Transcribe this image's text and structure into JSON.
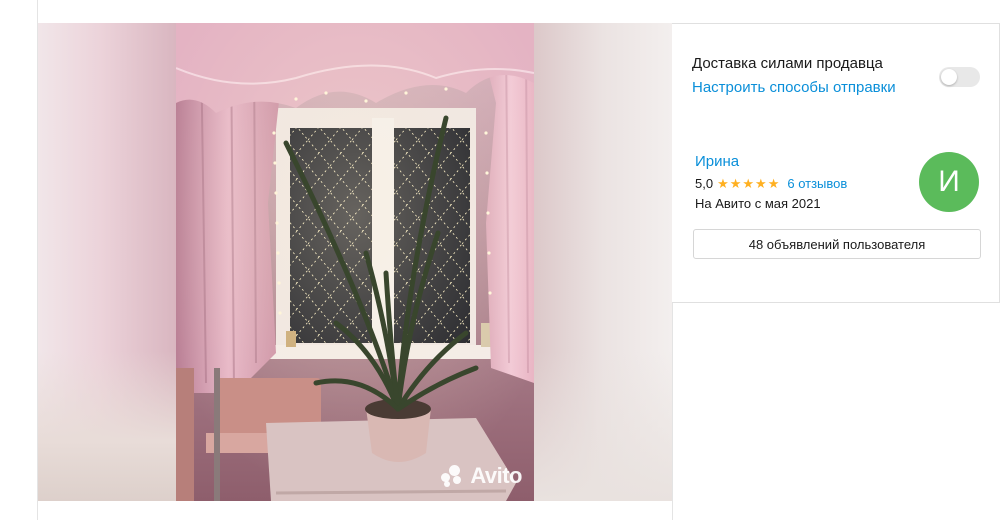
{
  "gallery": {
    "photo_alt": "",
    "watermark": "Avito"
  },
  "delivery": {
    "title": "Доставка силами продавца",
    "link": "Настроить способы отправки",
    "enabled": false
  },
  "seller": {
    "name": "Ирина",
    "rating": "5,0",
    "stars": 5,
    "reviews": "6 отзывов",
    "since": "На Авито с мая 2021",
    "avatar_letter": "И",
    "avatar_color": "#5bbb5b",
    "ads_button": "48 объявлений пользователя"
  },
  "colors": {
    "link": "#0a8fd9",
    "star": "#ffb021"
  }
}
